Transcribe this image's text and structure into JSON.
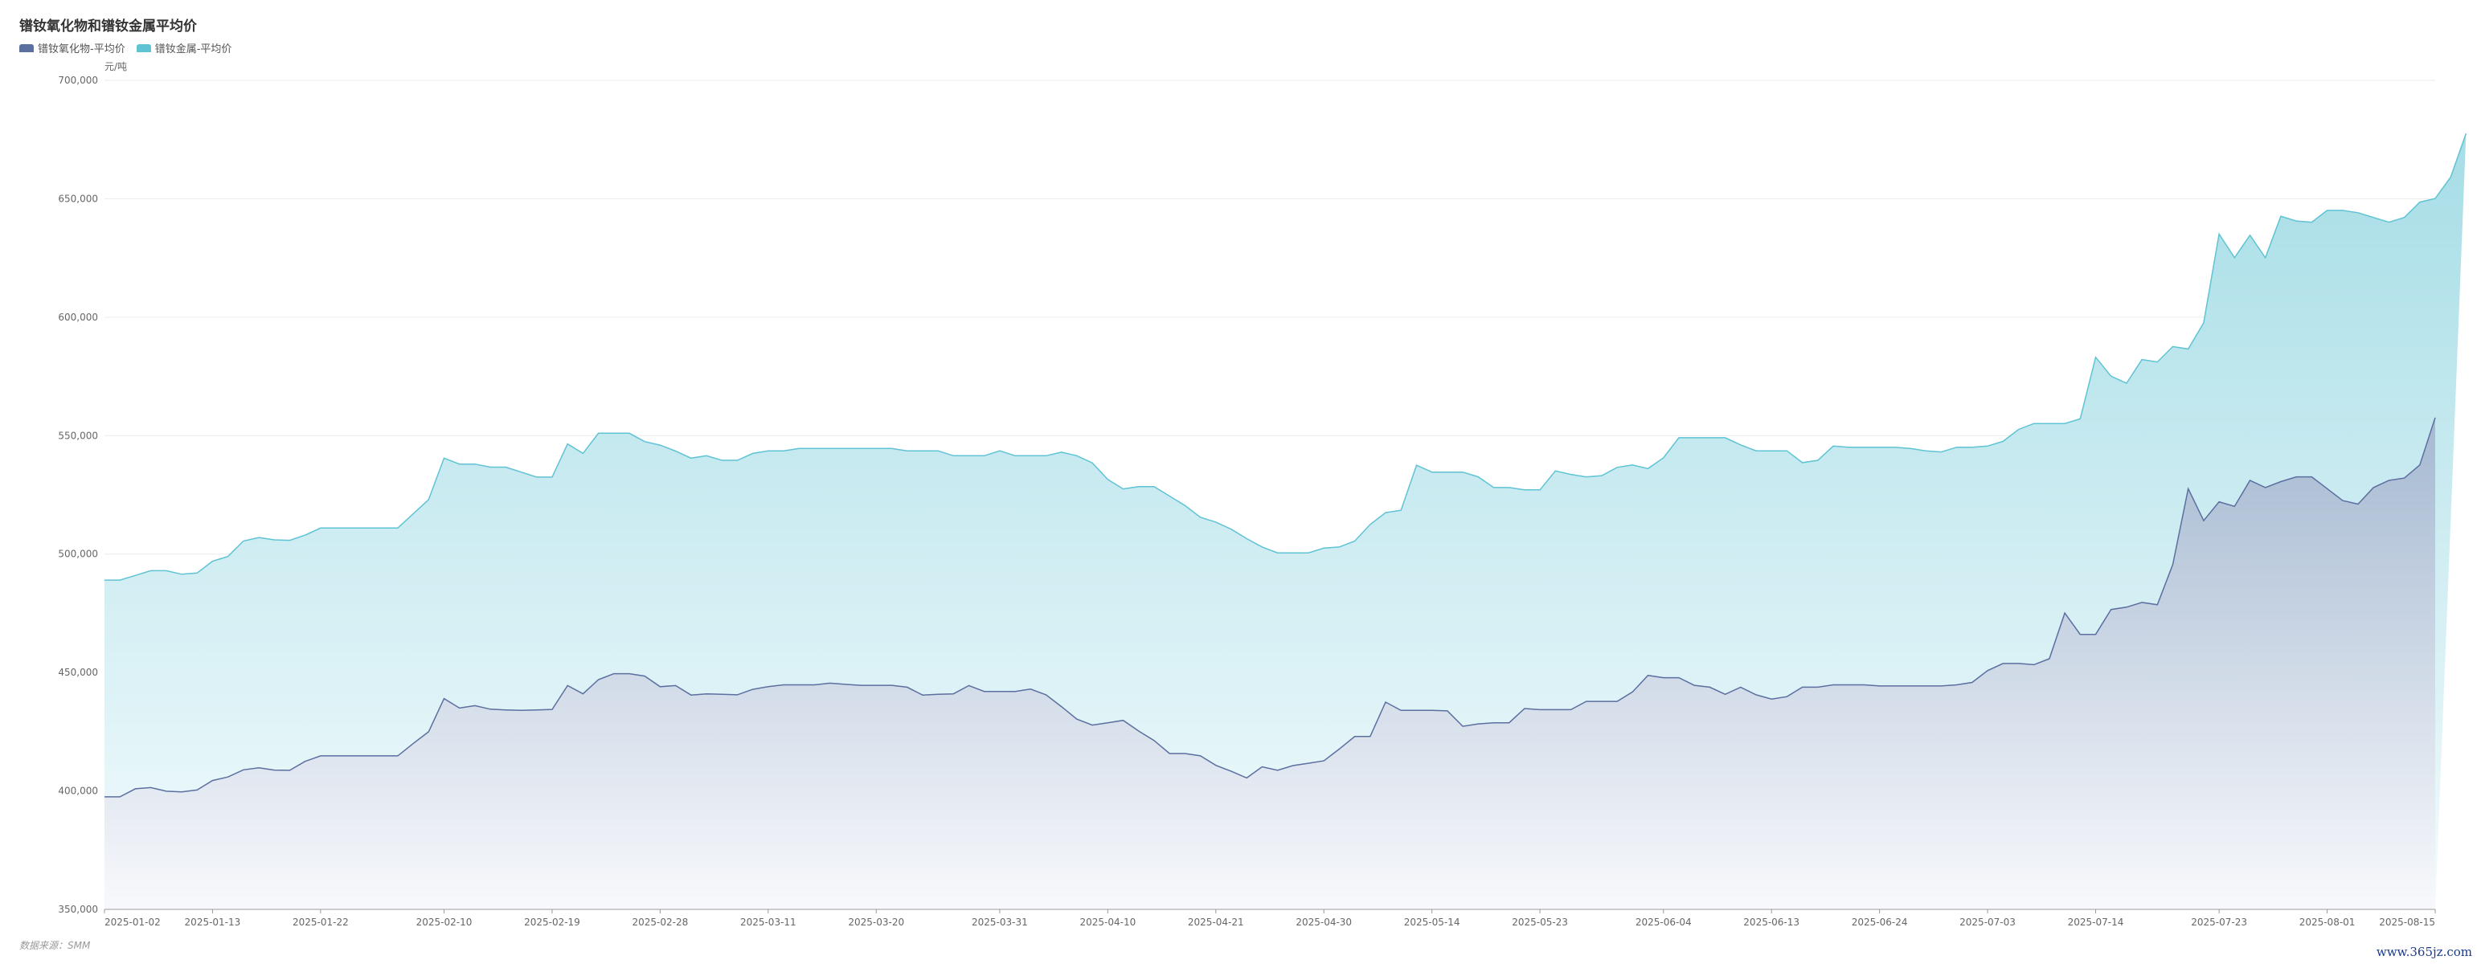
{
  "title": "镨钕氧化物和镨钕金属平均价",
  "unit": "元/吨",
  "source": "数据来源：SMM",
  "watermark": "www.365jz.com",
  "chart_data": {
    "type": "area",
    "title": "镨钕氧化物和镨钕金属平均价",
    "ylabel": "元/吨",
    "ylim": [
      350000,
      700000
    ],
    "yticks": [
      350000,
      400000,
      450000,
      500000,
      550000,
      600000,
      650000,
      700000
    ],
    "ytick_labels": [
      "350,000",
      "400,000",
      "450,000",
      "500,000",
      "550,000",
      "600,000",
      "650,000",
      "700,000"
    ],
    "xtick_labels": [
      "2025-01-02",
      "2025-01-13",
      "2025-01-22",
      "2025-02-10",
      "2025-02-19",
      "2025-02-28",
      "2025-03-11",
      "2025-03-20",
      "2025-03-31",
      "2025-04-10",
      "2025-04-21",
      "2025-04-30",
      "2025-05-14",
      "2025-05-23",
      "2025-06-04",
      "2025-06-13",
      "2025-06-24",
      "2025-07-03",
      "2025-07-14",
      "2025-07-23",
      "2025-08-01",
      "2025-08-15"
    ],
    "grid": true,
    "legend": "top-left",
    "series": [
      {
        "name": "镨钕氧化物-平均价",
        "color": "#5b6fa0",
        "values": [
          397500,
          397500,
          400900,
          401400,
          399900,
          399600,
          400400,
          404400,
          405900,
          408900,
          409800,
          408800,
          408700,
          412500,
          414800,
          414800,
          414800,
          414800,
          414800,
          414800,
          420000,
          425000,
          439000,
          435000,
          436000,
          434500,
          434200,
          434000,
          434200,
          434400,
          444500,
          441000,
          447000,
          449500,
          449500,
          448500,
          444000,
          444500,
          440500,
          441000,
          440800,
          440600,
          442900,
          444000,
          444800,
          444800,
          444800,
          445500,
          445000,
          444600,
          444600,
          444600,
          443800,
          440500,
          440800,
          441000,
          444500,
          442000,
          442000,
          442000,
          443000,
          440600,
          435600,
          430300,
          427800,
          428800,
          429800,
          425300,
          421300,
          415800,
          415800,
          414800,
          410800,
          408300,
          405500,
          410200,
          408700,
          410700,
          411700,
          412700,
          417700,
          423000,
          423000,
          437500,
          434000,
          434000,
          434000,
          433800,
          427300,
          428300,
          428800,
          428800,
          434800,
          434300,
          434300,
          434300,
          437800,
          437800,
          437800,
          441800,
          448800,
          447800,
          447800,
          444600,
          443800,
          440800,
          443800,
          440600,
          438800,
          439800,
          443800,
          443800,
          444800,
          444800,
          444800,
          444300,
          444300,
          444300,
          444300,
          444300,
          444800,
          445800,
          450800,
          453800,
          453800,
          453300,
          455800,
          475100,
          466100,
          466100,
          476600,
          477600,
          479600,
          478600,
          495600,
          527600,
          514100,
          522100,
          520100,
          531100,
          528100,
          530600,
          532600,
          532600,
          527600,
          522600,
          521100,
          528100,
          531100,
          532100,
          537600,
          557600
        ]
      },
      {
        "name": "镨钕金属-平均价",
        "color": "#5fc3d4",
        "values": [
          489000,
          489000,
          491000,
          493000,
          493000,
          491500,
          492000,
          497000,
          499000,
          505500,
          507000,
          506000,
          505800,
          508000,
          511000,
          511000,
          511000,
          511000,
          511000,
          511000,
          517000,
          523000,
          540500,
          538000,
          538000,
          536700,
          536700,
          534600,
          532500,
          532500,
          546500,
          542500,
          551000,
          551000,
          551000,
          547500,
          546000,
          543500,
          540500,
          541500,
          539600,
          539600,
          542500,
          543600,
          543600,
          544600,
          544600,
          544600,
          544600,
          544600,
          544600,
          544600,
          543600,
          543600,
          543600,
          541500,
          541500,
          541500,
          543600,
          541500,
          541500,
          541500,
          543000,
          541500,
          538500,
          531500,
          527500,
          528500,
          528500,
          524500,
          520500,
          515500,
          513500,
          510500,
          506500,
          503000,
          500500,
          500500,
          500500,
          502500,
          503000,
          505500,
          512500,
          517500,
          518500,
          537500,
          534600,
          534600,
          534600,
          532600,
          528100,
          528100,
          527100,
          527100,
          535100,
          533600,
          532600,
          533100,
          536600,
          537600,
          536100,
          540600,
          549100,
          549100,
          549100,
          549100,
          546100,
          543600,
          543600,
          543600,
          538600,
          539600,
          545600,
          545100,
          545100,
          545100,
          545100,
          544600,
          543600,
          543100,
          545100,
          545100,
          545600,
          547600,
          552600,
          555100,
          555100,
          555100,
          557100,
          583100,
          575100,
          572100,
          582100,
          581100,
          587600,
          586600,
          597600,
          635100,
          625100,
          634600,
          625100,
          642600,
          640600,
          640100,
          645100,
          645100,
          644100,
          642100,
          640100,
          642100,
          648600,
          650100,
          659100,
          677600
        ]
      }
    ]
  }
}
